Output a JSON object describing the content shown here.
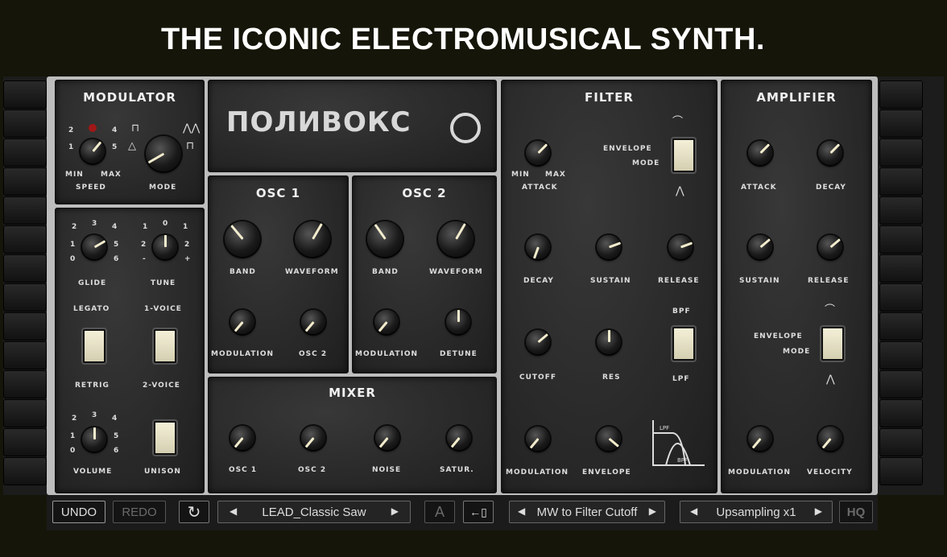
{
  "headline": "THE ICONIC ELECTROMUSICAL SYNTH.",
  "logo_text": "ПОЛИВОКС",
  "modulator": {
    "title": "MODULATOR",
    "speed": "SPEED",
    "mode": "MODE",
    "min": "MIN",
    "max": "MAX",
    "t1": "1",
    "t2": "2",
    "t4": "4",
    "t5": "5"
  },
  "performance": {
    "glide": "GLIDE",
    "tune": "TUNE",
    "legato": "LEGATO",
    "one_voice": "1-VOICE",
    "retrig": "RETRIG",
    "two_voice": "2-VOICE",
    "volume": "VOLUME",
    "unison": "UNISON",
    "t0": "0",
    "t1": "1",
    "t2": "2",
    "t3": "3",
    "t4": "4",
    "t5": "5",
    "t6": "6",
    "minus": "-",
    "plus": "+"
  },
  "osc1": {
    "title": "OSC 1",
    "band": "BAND",
    "waveform": "WAVEFORM",
    "modulation": "MODULATION",
    "osc2": "OSC 2"
  },
  "osc2": {
    "title": "OSC 2",
    "band": "BAND",
    "waveform": "WAVEFORM",
    "modulation": "MODULATION",
    "detune": "DETUNE"
  },
  "mixer": {
    "title": "MIXER",
    "osc1": "OSC 1",
    "osc2": "OSC 2",
    "noise": "NOISE",
    "satur": "SATUR."
  },
  "filter": {
    "title": "FILTER",
    "attack": "ATTACK",
    "envelope": "ENVELOPE",
    "mode": "MODE",
    "decay": "DECAY",
    "sustain": "SUSTAIN",
    "release": "RELEASE",
    "cutoff": "CUTOFF",
    "res": "RES",
    "bpf": "BPF",
    "lpf": "LPF",
    "modulation": "MODULATION",
    "env": "ENVELOPE",
    "graph_lpf": "LPF",
    "graph_bpf": "BPF",
    "min": "MIN",
    "max": "MAX"
  },
  "amplifier": {
    "title": "AMPLIFIER",
    "attack": "ATTACK",
    "decay": "DECAY",
    "sustain": "SUSTAIN",
    "release": "RELEASE",
    "envelope": "ENVELOPE",
    "mode": "MODE",
    "modulation": "MODULATION",
    "velocity": "VELOCITY"
  },
  "toolbar": {
    "undo": "UNDO",
    "redo": "REDO",
    "preset": "LEAD_Classic Saw",
    "a_label": "A",
    "mw": "MW to Filter Cutoff",
    "upsampling": "Upsampling x1",
    "hq": "HQ"
  }
}
